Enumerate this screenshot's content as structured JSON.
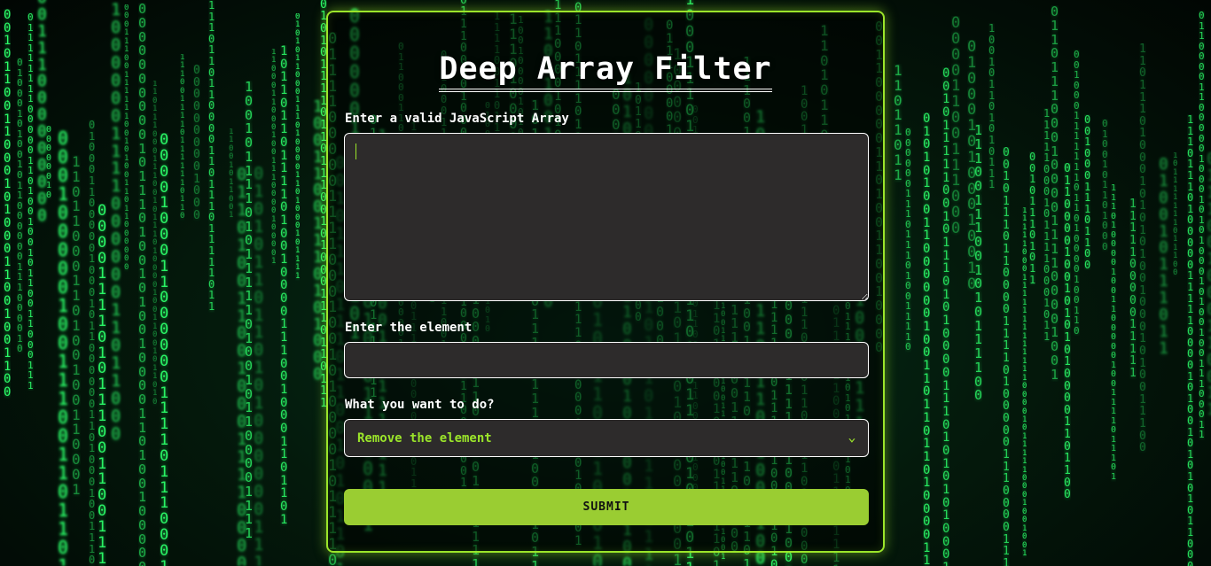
{
  "page": {
    "title": "Deep Array Filter"
  },
  "form": {
    "array_label": "Enter a valid JavaScript Array",
    "array_value": "",
    "element_label": "Enter the element",
    "element_value": "",
    "action_label": "What you want to do?",
    "action_selected": "Remove the element",
    "submit_label": "SUBMIT"
  },
  "background": {
    "glyphs": [
      "0",
      "1"
    ],
    "description_icon": "matrix-rain-background"
  },
  "colors": {
    "accent": "#9ACD32",
    "field_background": "#2D2B2B",
    "field_text": "#9BE52A",
    "matrix_green": "#2CFF6A"
  }
}
